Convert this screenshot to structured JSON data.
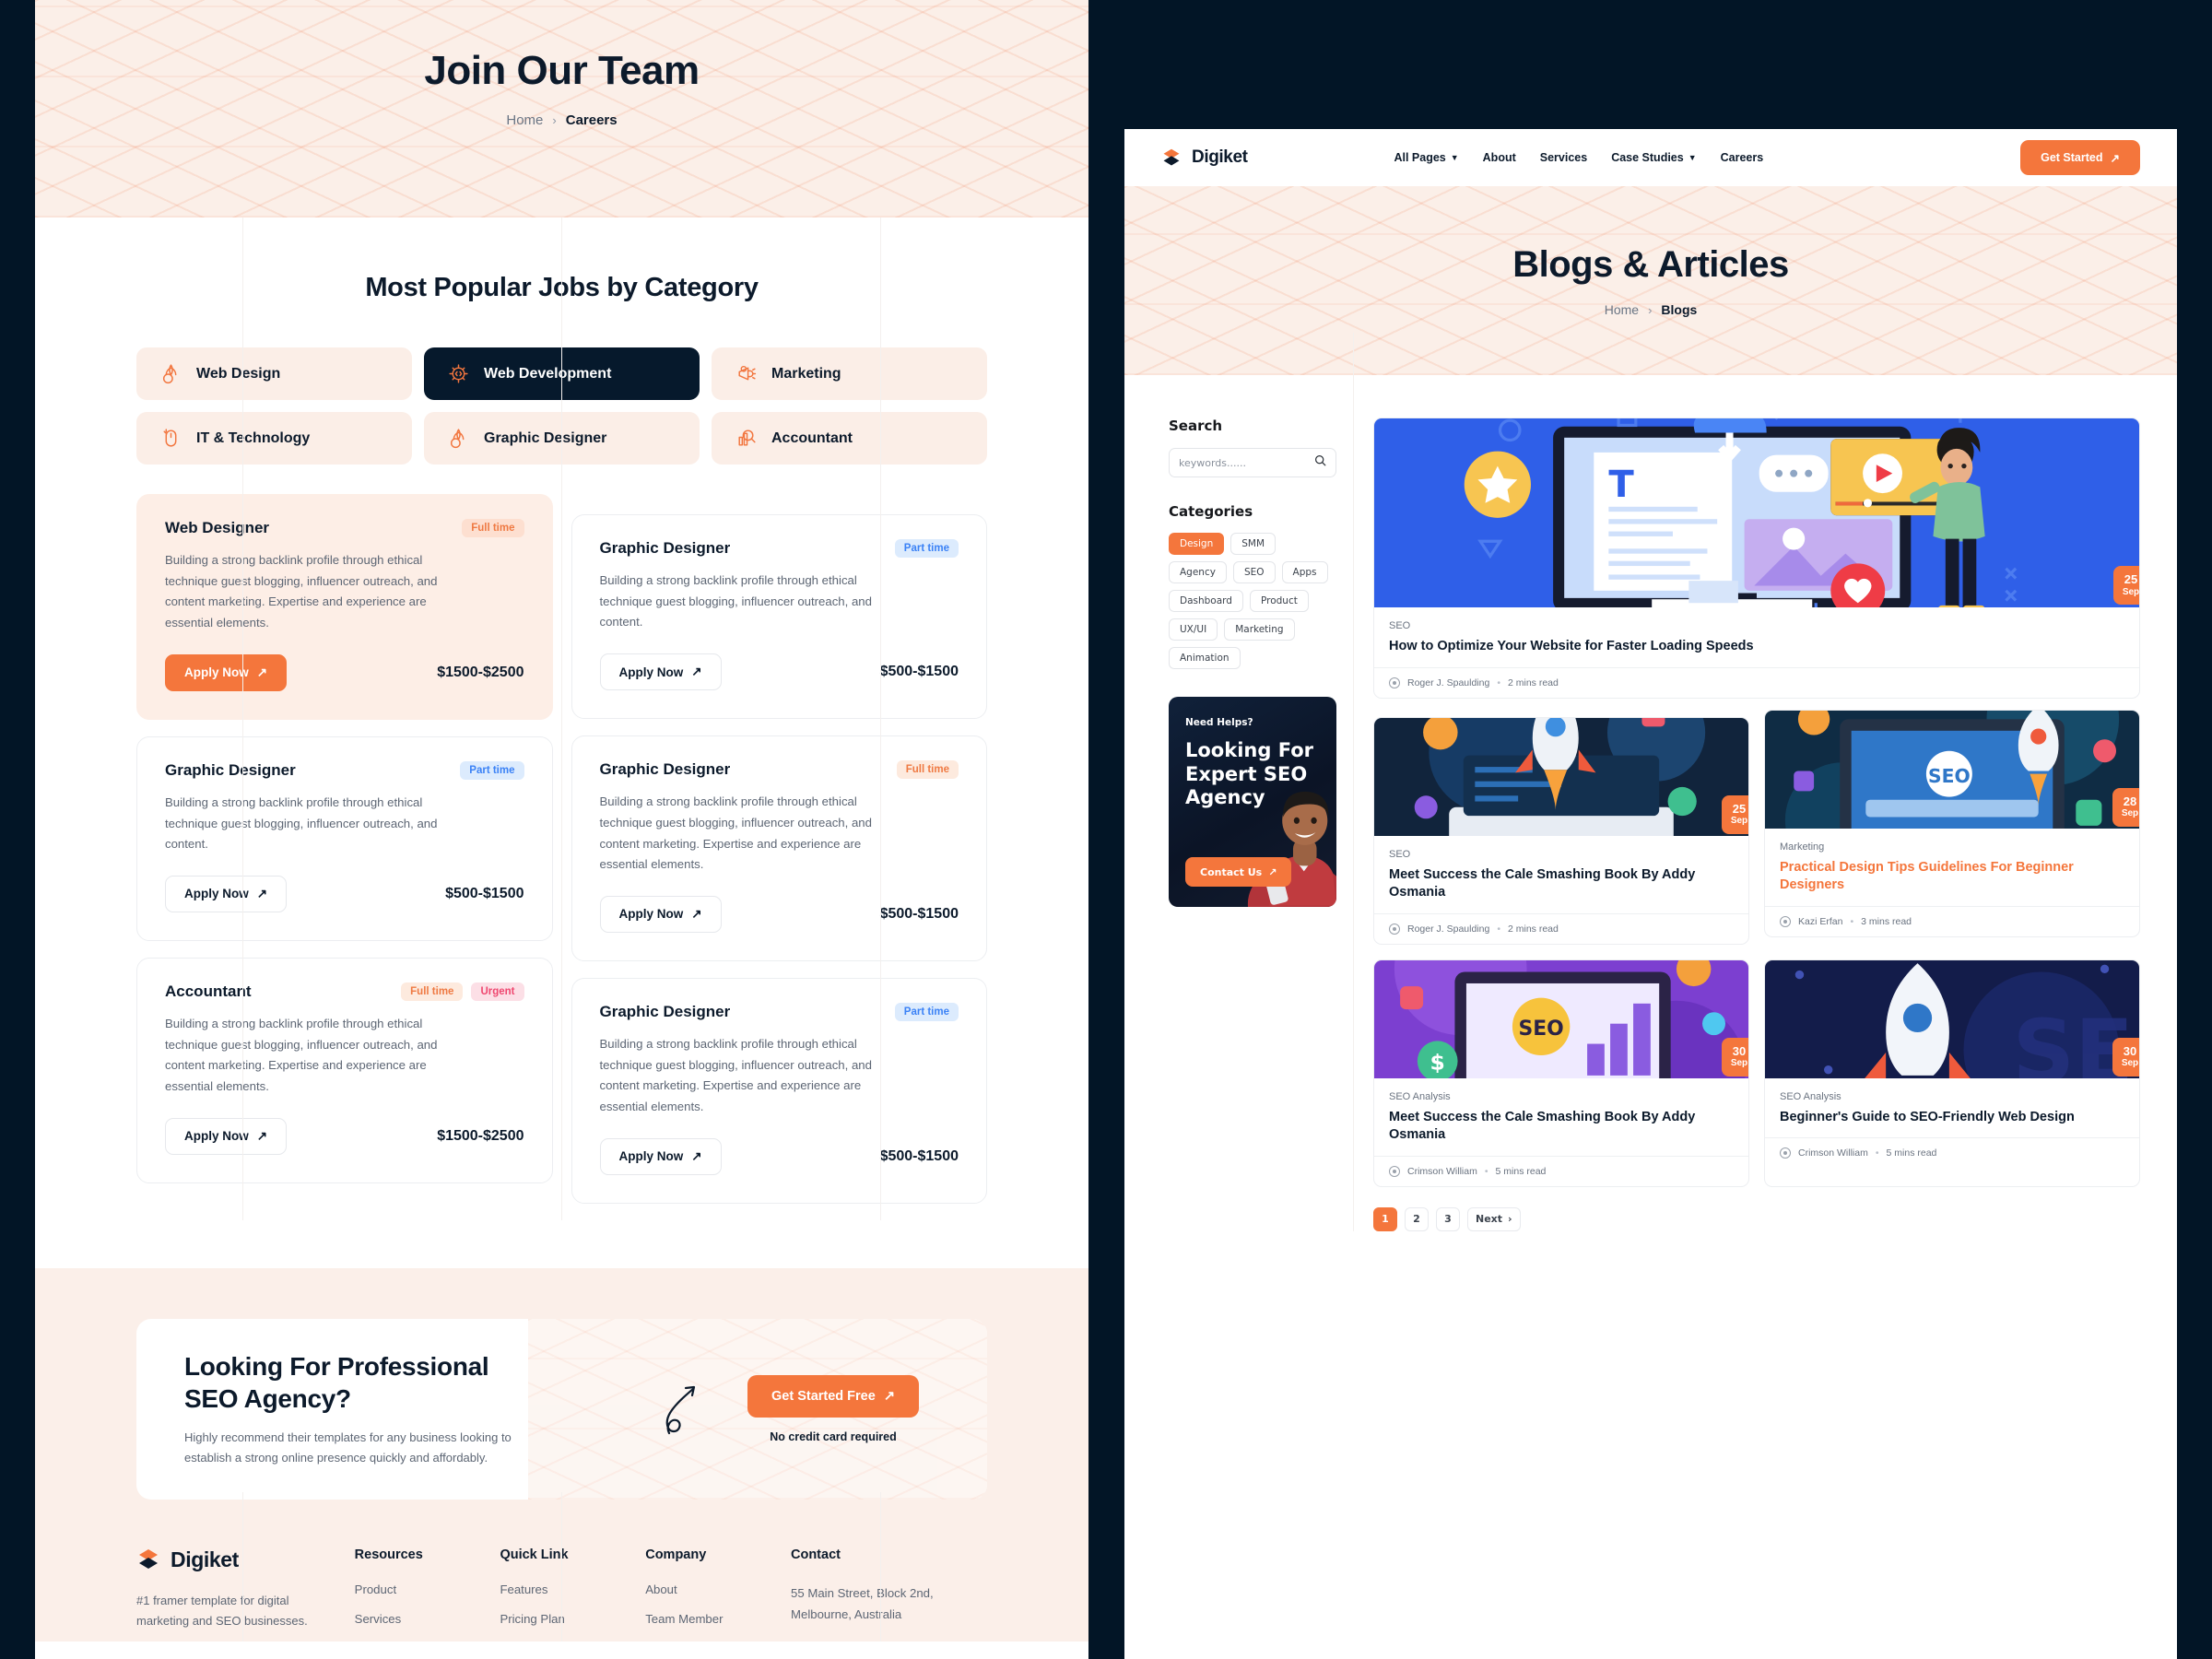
{
  "left_page": {
    "hero": {
      "title": "Join Our Team",
      "crumb_home": "Home",
      "crumb_sep": "›",
      "crumb_current": "Careers"
    },
    "section_title": "Most Popular Jobs by Category",
    "categories": [
      {
        "label": "Web Design",
        "icon": "wheat-gear-icon",
        "active": false
      },
      {
        "label": "Web Development",
        "icon": "code-gear-icon",
        "active": true
      },
      {
        "label": "Marketing",
        "icon": "megaphone-icon",
        "active": false
      },
      {
        "label": "IT & Technology",
        "icon": "mouse-icon",
        "active": false
      },
      {
        "label": "Graphic Designer",
        "icon": "wheat-gear-icon",
        "active": false
      },
      {
        "label": "Accountant",
        "icon": "chart-magnifier-icon",
        "active": false
      }
    ],
    "jobs_left": [
      {
        "title": "Web Designer",
        "tags": [
          {
            "text": "Full time",
            "type": "full"
          }
        ],
        "desc": "Building a strong backlink profile through ethical technique guest blogging, influencer outreach, and content marketing. Expertise and experience are essential elements.",
        "apply": "Apply Now",
        "price": "$1500-$2500",
        "highlight": true
      },
      {
        "title": "Graphic Designer",
        "tags": [
          {
            "text": "Part time",
            "type": "part"
          }
        ],
        "desc": "Building a strong backlink profile through ethical technique guest blogging, influencer outreach, and content.",
        "apply": "Apply Now",
        "price": "$500-$1500",
        "highlight": false
      },
      {
        "title": "Accountant",
        "tags": [
          {
            "text": "Full time",
            "type": "full2"
          },
          {
            "text": "Urgent",
            "type": "urg"
          }
        ],
        "desc": "Building a strong backlink profile through ethical technique guest blogging, influencer outreach, and content marketing. Expertise and experience are essential elements.",
        "apply": "Apply Now",
        "price": "$1500-$2500",
        "highlight": false
      }
    ],
    "jobs_right": [
      {
        "title": "Graphic Designer",
        "tags": [
          {
            "text": "Part time",
            "type": "part"
          }
        ],
        "desc": "Building a strong backlink profile through ethical technique guest blogging, influencer outreach, and content.",
        "apply": "Apply Now",
        "price": "$500-$1500",
        "highlight": false
      },
      {
        "title": "Graphic Designer",
        "tags": [
          {
            "text": "Full time",
            "type": "full2"
          }
        ],
        "desc": "Building a strong backlink profile through ethical technique guest blogging, influencer outreach, and content marketing. Expertise and experience are essential elements.",
        "apply": "Apply Now",
        "price": "$500-$1500",
        "highlight": false
      },
      {
        "title": "Graphic Designer",
        "tags": [
          {
            "text": "Part time",
            "type": "part"
          }
        ],
        "desc": "Building a strong backlink profile through ethical technique guest blogging, influencer outreach, and content marketing. Expertise and experience are essential elements.",
        "apply": "Apply Now",
        "price": "$500-$1500",
        "highlight": false
      }
    ],
    "cta": {
      "title_line1": "Looking For Professional",
      "title_line2": "SEO Agency?",
      "desc": "Highly recommend their templates for any business looking to establish a strong online presence quickly and affordably.",
      "button": "Get Started Free",
      "note": "No credit card required"
    },
    "footer": {
      "brand": "Digiket",
      "brand_desc": "#1 framer template for digital marketing and SEO businesses.",
      "columns": [
        {
          "title": "Resources",
          "items": [
            "Product",
            "Services"
          ]
        },
        {
          "title": "Quick Link",
          "items": [
            "Features",
            "Pricing Plan"
          ]
        },
        {
          "title": "Company",
          "items": [
            "About",
            "Team Member"
          ]
        }
      ],
      "contact_title": "Contact",
      "contact_address": "55 Main Street, Block 2nd, Melbourne, Australia"
    }
  },
  "right_page": {
    "nav": {
      "brand": "Digiket",
      "items": [
        {
          "label": "All Pages",
          "caret": true
        },
        {
          "label": "About",
          "caret": false
        },
        {
          "label": "Services",
          "caret": false
        },
        {
          "label": "Case Studies",
          "caret": true
        },
        {
          "label": "Careers",
          "caret": false
        }
      ],
      "cta": "Get Started"
    },
    "hero": {
      "title": "Blogs & Articles",
      "crumb_home": "Home",
      "crumb_sep": "›",
      "crumb_current": "Blogs"
    },
    "sidebar": {
      "search_label": "Search",
      "search_placeholder": "keywords......",
      "search_value": "",
      "categories_label": "Categories",
      "chips": [
        {
          "label": "Design",
          "on": true
        },
        {
          "label": "SMM",
          "on": false
        },
        {
          "label": "Agency",
          "on": false
        },
        {
          "label": "SEO",
          "on": false
        },
        {
          "label": "Apps",
          "on": false
        },
        {
          "label": "Dashboard",
          "on": false
        },
        {
          "label": "Product",
          "on": false
        },
        {
          "label": "UX/UI",
          "on": false
        },
        {
          "label": "Marketing",
          "on": false
        },
        {
          "label": "Animation",
          "on": false
        }
      ],
      "promo": {
        "eyebrow": "Need Helps?",
        "title": "Looking For Expert SEO Agency",
        "button": "Contact Us"
      }
    },
    "featured": {
      "category": "SEO",
      "title": "How to Optimize Your Website for Faster Loading Speeds",
      "author": "Roger J. Spaulding",
      "read": "2 mins read",
      "date_day": "25",
      "date_month": "Sep",
      "thumb": "desktop-media-illustration"
    },
    "posts": [
      {
        "category": "SEO",
        "title": "Meet Success the Cale Smashing Book By Addy Osmania",
        "author": "Roger J. Spaulding",
        "read": "2 mins read",
        "date_day": "25",
        "date_month": "Sep",
        "highlight": false,
        "thumb": "rocket-laptop-illustration"
      },
      {
        "category": "Marketing",
        "title": "Practical Design Tips Guidelines For Beginner Designers",
        "author": "Kazi Erfan",
        "read": "3 mins read",
        "date_day": "28",
        "date_month": "Sep",
        "highlight": true,
        "thumb": "seo-laptop-illustration"
      },
      {
        "category": "SEO Analysis",
        "title": "Meet Success the Cale Smashing Book By Addy Osmania",
        "author": "Crimson William",
        "read": "5 mins read",
        "date_day": "30",
        "date_month": "Sep",
        "highlight": false,
        "thumb": "seo-analytics-illustration"
      },
      {
        "category": "SEO Analysis",
        "title": "Beginner's Guide to SEO-Friendly Web Design",
        "author": "Crimson William",
        "read": "5 mins read",
        "date_day": "30",
        "date_month": "Sep",
        "highlight": false,
        "thumb": "seo-rocket-illustration"
      }
    ],
    "pagination": {
      "pages": [
        "1",
        "2",
        "3"
      ],
      "current": "1",
      "next": "Next"
    }
  },
  "colors": {
    "accent": "#f4763c",
    "dark": "#0c1a2b",
    "canvas_dark": "#021526",
    "cream": "#fbefe9",
    "tag_blue": "#3b82f6",
    "tag_pink": "#ef4870"
  }
}
